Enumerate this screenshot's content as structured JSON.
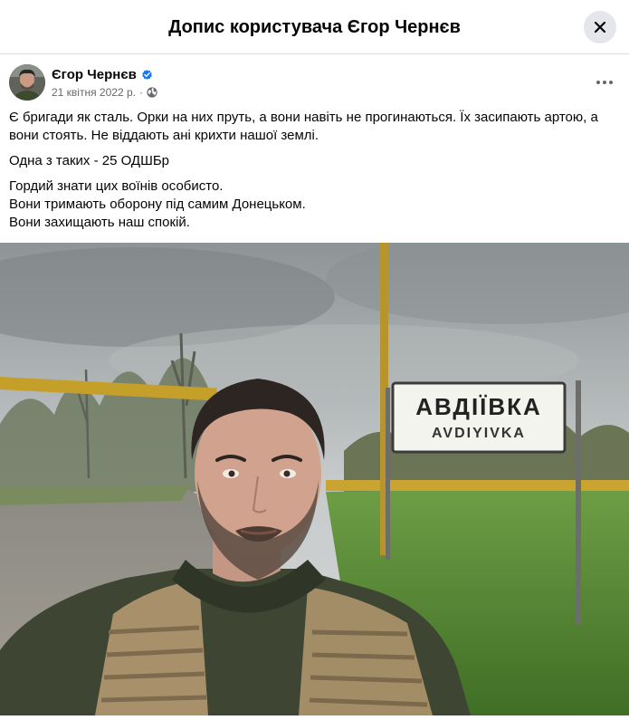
{
  "dialog": {
    "title": "Допис користувача Єгор Чернєв",
    "close_icon": "close-icon"
  },
  "post": {
    "author": "Єгор Чернєв",
    "verified_icon": "verified-badge-icon",
    "date": "21 квітня 2022 р.",
    "separator": "·",
    "privacy_icon": "globe-icon",
    "more_icon": "more-horizontal-icon",
    "paragraphs": [
      "Є бригади як сталь. Орки на них пруть, а вони навіть не прогинаються. Їх засипають артою, а вони стоять. Не віддають ані крихти нашої землі.",
      "Одна з таких - 25 ОДШБр",
      "Гордий знати цих воїнів особисто."
    ],
    "lines": [
      "Вони тримають оборону під самим Донецьком.",
      "Вони захищають наш спокій."
    ],
    "photo": {
      "sign_cyrillic": "АВДІЇВКА",
      "sign_latin": "AVDIYIVKA"
    }
  },
  "colors": {
    "verified": "#1877f2",
    "divider": "#dadde1",
    "secondary_text": "#65676b",
    "close_bg": "#e4e6eb"
  }
}
